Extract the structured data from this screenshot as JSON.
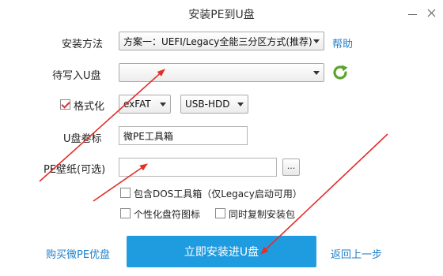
{
  "window": {
    "title": "安装PE到U盘"
  },
  "form": {
    "install_method_label": "安装方法",
    "install_method_value": "方案一：UEFI/Legacy全能三分区方式(推荐)",
    "help_label": "帮助",
    "usb_label": "待写入U盘",
    "usb_value": "",
    "format_label": "格式化",
    "format_checked": true,
    "filesystem_value": "exFAT",
    "mode_value": "USB-HDD",
    "volume_label": "U盘卷标",
    "volume_value": "微PE工具箱",
    "wallpaper_label": "PE壁纸(可选)",
    "wallpaper_value": "",
    "browse_label": "...",
    "options": [
      {
        "label": "包含DOS工具箱（仅Legacy启动可用）",
        "checked": false
      },
      {
        "label": "个性化盘符图标",
        "checked": false
      },
      {
        "label": "同时复制安装包",
        "checked": false
      }
    ]
  },
  "footer": {
    "buy_label": "购买微PE优盘",
    "install_label": "立即安装进U盘",
    "back_label": "返回上一步"
  },
  "colors": {
    "accent": "#1f9be0",
    "link": "#1e7ec8",
    "annotation_arrow": "#e0302a",
    "refresh": "#5aa52a"
  }
}
